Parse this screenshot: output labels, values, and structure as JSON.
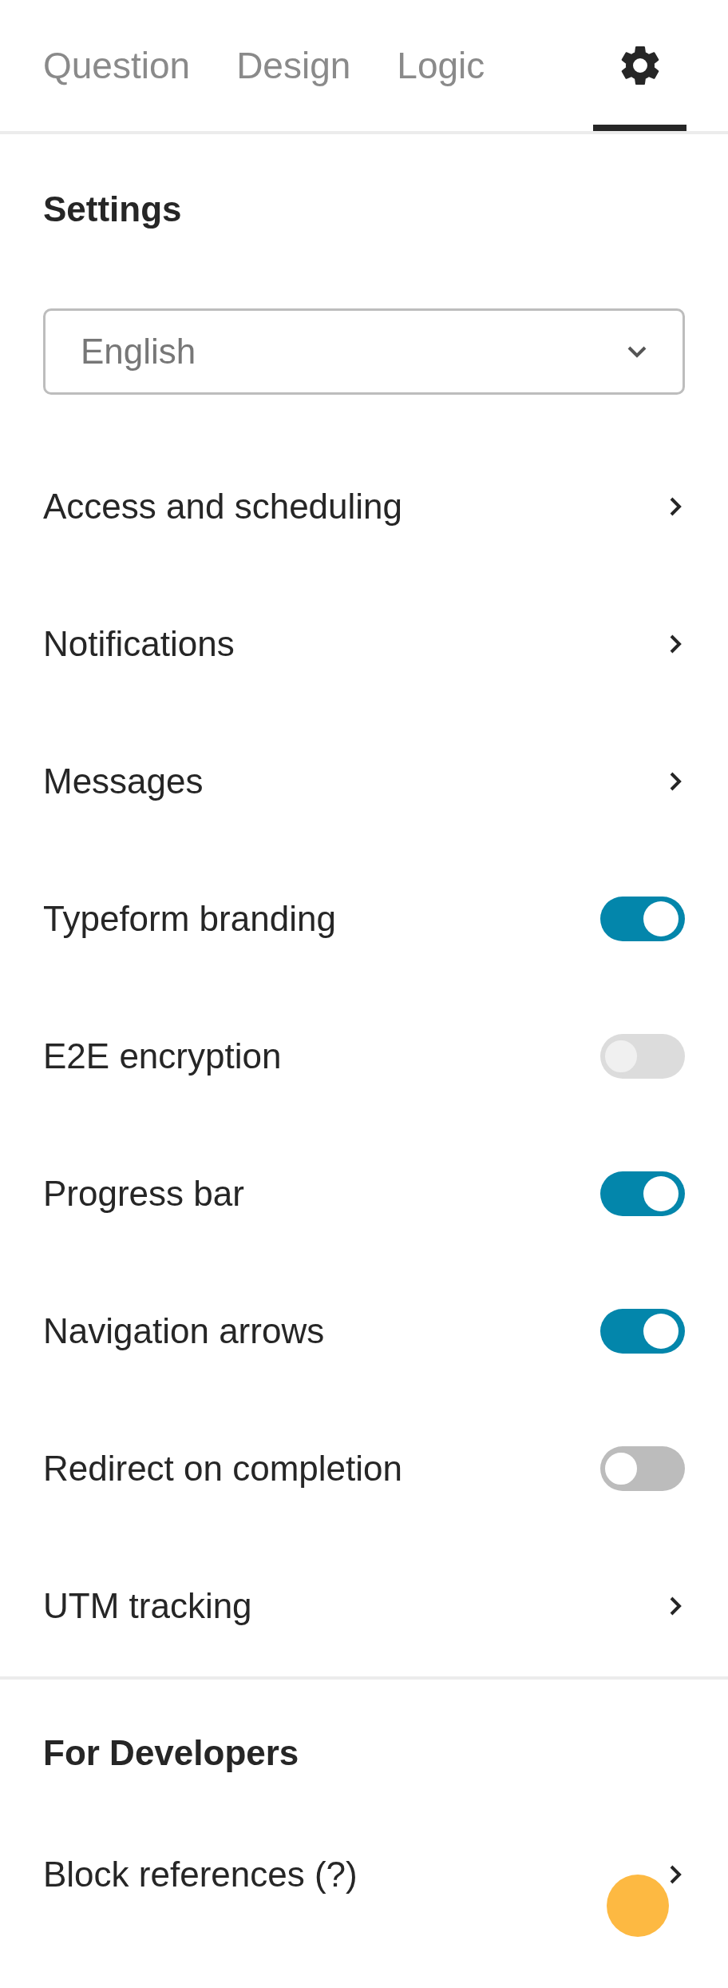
{
  "tabs": [
    {
      "kind": "text",
      "label": "Question",
      "selected": false
    },
    {
      "kind": "text",
      "label": "Design",
      "selected": false
    },
    {
      "kind": "text",
      "label": "Logic",
      "selected": false
    },
    {
      "kind": "icon",
      "selected": true
    }
  ],
  "settings": {
    "heading": "Settings",
    "language": {
      "value": "English"
    },
    "rows": [
      {
        "kind": "link",
        "label": "Access and scheduling"
      },
      {
        "kind": "link",
        "label": "Notifications"
      },
      {
        "kind": "link",
        "label": "Messages"
      },
      {
        "kind": "toggle",
        "label": "Typeform branding",
        "on": true,
        "disabled": false
      },
      {
        "kind": "toggle",
        "label": "E2E encryption",
        "on": false,
        "disabled": true
      },
      {
        "kind": "toggle",
        "label": "Progress bar",
        "on": true,
        "disabled": false
      },
      {
        "kind": "toggle",
        "label": "Navigation arrows",
        "on": true,
        "disabled": false
      },
      {
        "kind": "toggle",
        "label": "Redirect on completion",
        "on": false,
        "disabled": false
      },
      {
        "kind": "link",
        "label": "UTM tracking"
      }
    ]
  },
  "developers": {
    "heading": "For Developers",
    "rows": [
      {
        "kind": "link",
        "label": "Block references (?)"
      }
    ]
  }
}
